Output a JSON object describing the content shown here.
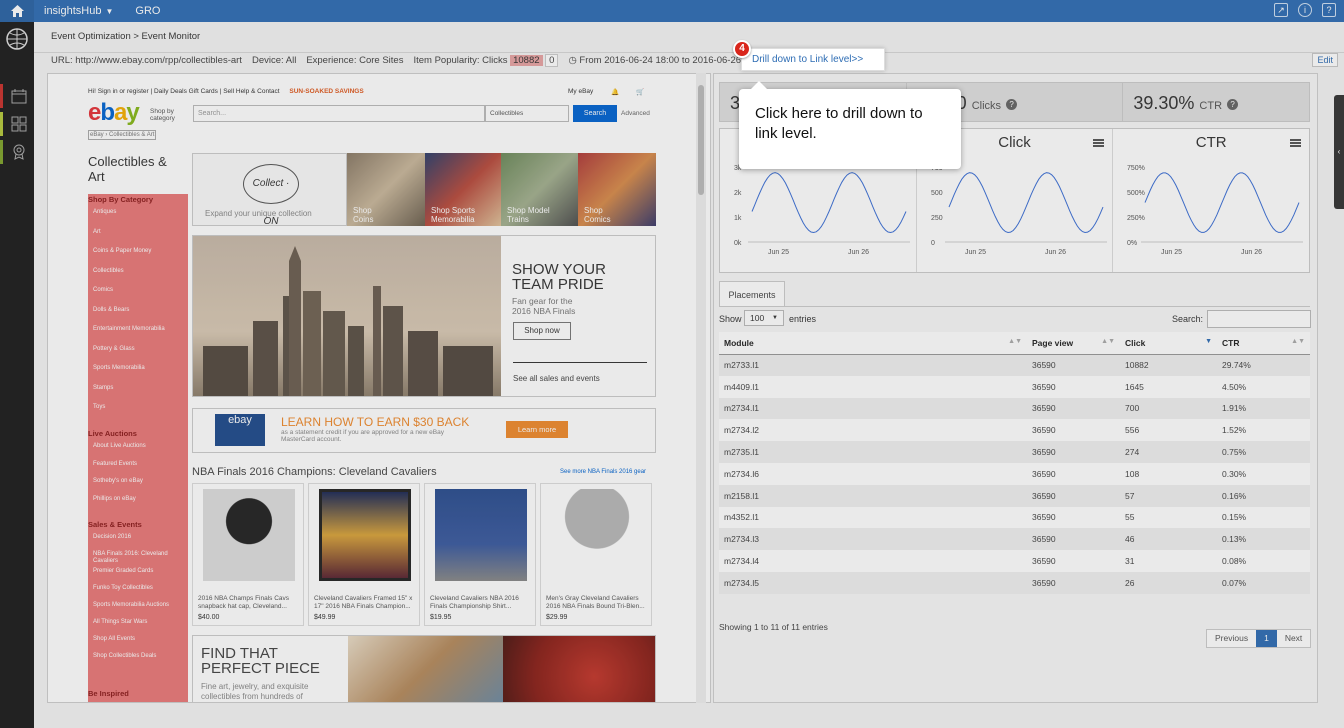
{
  "topbar": {
    "app_name": "insightsHub",
    "gro_label": "GRO"
  },
  "breadcrumb": "Event Optimization > Event Monitor",
  "urlbar": {
    "url_label": "URL: http://www.ebay.com/rpp/collectibles-art",
    "device_label": "Device: All",
    "experience_label": "Experience: Core Sites",
    "popularity_label": "Item Popularity: Clicks",
    "popularity_value": "10882",
    "popularity_zero": "0",
    "date_range": "From 2016-06-24 18:00 to 2016-06-26 18:00 PST",
    "edit_label": "Edit"
  },
  "ebay_page": {
    "top_links": "Hi! Sign in or register  |  Daily Deals    Gift Cards  |  Sell    Help & Contact",
    "promo": "SUN-SOAKED SAVINGS",
    "my_ebay": "My eBay",
    "shop_by": "Shop by category",
    "search_placeholder": "Search...",
    "category_select": "Collectibles",
    "search_button": "Search",
    "advanced": "Advanced",
    "crumb": "eBay  ›  Collectibles & Art",
    "page_heading": "Collectibles & Art",
    "shop_by_category": "Shop By Category",
    "categories": [
      "Antiques",
      "Art",
      "Coins & Paper Money",
      "Collectibles",
      "Comics",
      "Dolls & Bears",
      "Entertainment Memorabilia",
      "Pottery & Glass",
      "Sports Memorabilia",
      "Stamps",
      "Toys"
    ],
    "live_auctions_head": "Live Auctions",
    "live_auctions": [
      "About Live Auctions",
      "Featured Events",
      "Sotheby's on eBay",
      "Phillips on eBay"
    ],
    "sales_head": "Sales & Events",
    "sales": [
      "Decision 2016",
      "NBA Finals 2016: Cleveland Cavaliers",
      "Premier Graded Cards",
      "Funko Toy Collectibles",
      "Sports Memorabilia Auctions",
      "All Things Star Wars",
      "Shop All Events",
      "Shop Collectibles Deals"
    ],
    "be_inspired": "Be Inspired",
    "collect_logo": "Collect · ON",
    "collect_tag": "Expand your unique collection",
    "tiles": [
      "Shop Coins",
      "Shop Sports Memorabilia",
      "Shop Model Trains",
      "Shop Comics"
    ],
    "team_title": "SHOW YOUR TEAM PRIDE",
    "team_sub": "Fan gear for the 2016 NBA Finals",
    "shop_now": "Shop now",
    "see_all": "See all sales and events",
    "mc_card": "ebay",
    "mc_title": "LEARN HOW TO EARN $30 BACK",
    "mc_sub": "as a statement credit if you are approved for a new eBay MasterCard account.",
    "learn_more": "Learn more",
    "nba_heading": "NBA Finals 2016 Champions: Cleveland Cavaliers",
    "nba_more": "See more NBA Finals 2016 gear",
    "products": [
      {
        "title": "2016 NBA Champs Finals Cavs snapback hat cap, Cleveland...",
        "price": "$40.00"
      },
      {
        "title": "Cleveland Cavaliers Framed 15\" x 17\" 2016 NBA Finals Champion...",
        "price": "$49.99"
      },
      {
        "title": "Cleveland Cavaliers NBA 2016 Finals Championship Shirt...",
        "price": "$19.95"
      },
      {
        "title": "Men's Gray Cleveland Cavaliers 2016 NBA Finals Bound Tri-Blen...",
        "price": "$29.99"
      }
    ],
    "find_title": "FIND THAT PERFECT PIECE",
    "find_sub": "Fine art, jewelry, and exquisite collectibles from hundreds of"
  },
  "stats": {
    "page_view_partial": "3",
    "clicks_value": "80",
    "clicks_label": "Clicks",
    "ctr_value": "39.30%",
    "ctr_label": "CTR"
  },
  "charts": [
    {
      "title": "",
      "yticks": [
        "3k",
        "2k",
        "1k",
        "0k"
      ],
      "xticks": [
        "Jun 25",
        "Jun 26"
      ]
    },
    {
      "title": "Click",
      "yticks": [
        "750",
        "500",
        "250",
        "0"
      ],
      "xticks": [
        "Jun 25",
        "Jun 26"
      ]
    },
    {
      "title": "CTR",
      "yticks": [
        "750%",
        "500%",
        "250%",
        "0%"
      ],
      "xticks": [
        "Jun 25",
        "Jun 26"
      ]
    }
  ],
  "table": {
    "tab_label": "Placements",
    "show_label": "Show",
    "show_value": "100",
    "entries_label": "entries",
    "search_label": "Search:",
    "columns": [
      "Module",
      "Page view",
      "Click",
      "CTR"
    ],
    "rows": [
      [
        "m2733.l1",
        "36590",
        "10882",
        "29.74%"
      ],
      [
        "m4409.l1",
        "36590",
        "1645",
        "4.50%"
      ],
      [
        "m2734.l1",
        "36590",
        "700",
        "1.91%"
      ],
      [
        "m2734.l2",
        "36590",
        "556",
        "1.52%"
      ],
      [
        "m2735.l1",
        "36590",
        "274",
        "0.75%"
      ],
      [
        "m2734.l6",
        "36590",
        "108",
        "0.30%"
      ],
      [
        "m2158.l1",
        "36590",
        "57",
        "0.16%"
      ],
      [
        "m4352.l1",
        "36590",
        "55",
        "0.15%"
      ],
      [
        "m2734.l3",
        "36590",
        "46",
        "0.13%"
      ],
      [
        "m2734.l4",
        "36590",
        "31",
        "0.08%"
      ],
      [
        "m2734.l5",
        "36590",
        "26",
        "0.07%"
      ]
    ],
    "showing": "Showing 1 to 11 of 11 entries",
    "prev": "Previous",
    "page": "1",
    "next": "Next"
  },
  "tutorial": {
    "step": "4",
    "link": "Drill down to Link level>>",
    "callout": "Click here to drill down to link level."
  }
}
